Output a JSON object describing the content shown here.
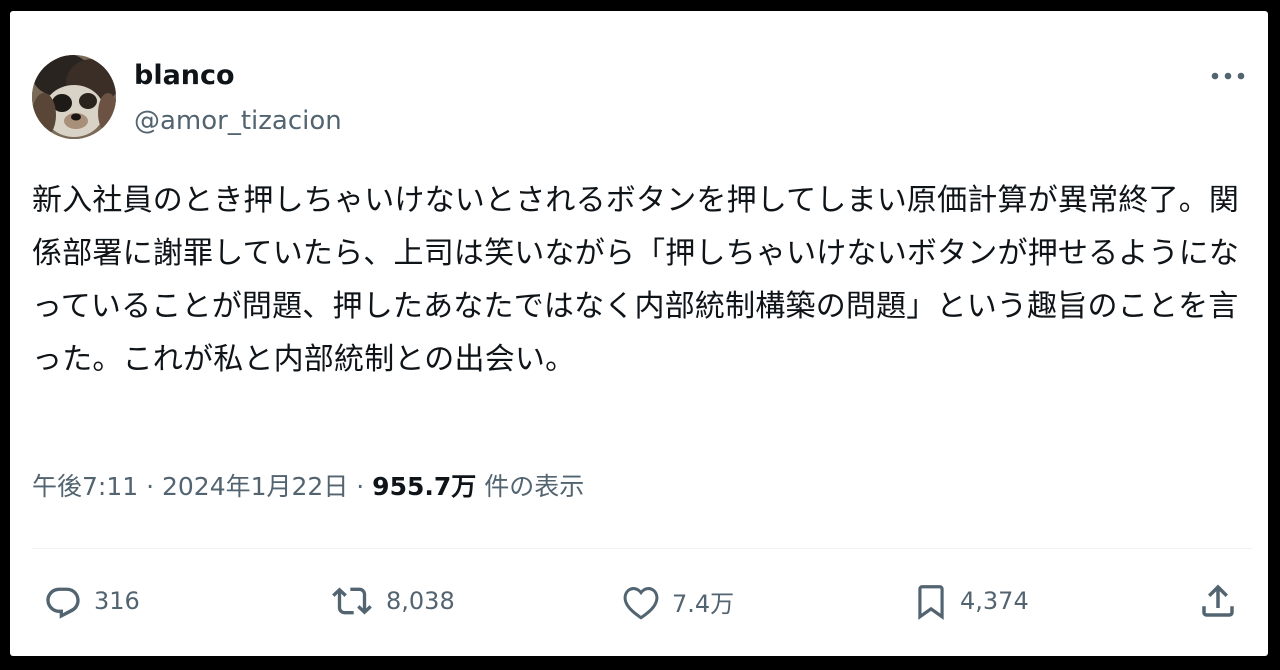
{
  "author": {
    "display_name": "blanco",
    "handle": "@amor_tizacion"
  },
  "tweet": {
    "text": "新入社員のとき押しちゃいけないとされるボタンを押してしまい原価計算が異常終了。関係部署に謝罪していたら、上司は笑いながら「押しちゃいけないボタンが押せるようになっていることが問題、押したあなたではなく内部統制構築の問題」という趣旨のことを言った。これが私と内部統制との出会い。"
  },
  "meta": {
    "time": "午後7:11",
    "separator": " · ",
    "date": "2024年1月22日",
    "views_count": "955.7万",
    "views_label": " 件の表示"
  },
  "actions": {
    "replies": {
      "count": "316",
      "icon": "reply-icon"
    },
    "retweets": {
      "count": "8,038",
      "icon": "retweet-icon"
    },
    "likes": {
      "count": "7.4万",
      "icon": "heart-icon"
    },
    "bookmarks": {
      "count": "4,374",
      "icon": "bookmark-icon"
    },
    "share": {
      "icon": "share-icon"
    }
  },
  "colors": {
    "text_primary": "#0f1419",
    "text_secondary": "#536471",
    "divider": "#eff3f4",
    "background": "#ffffff",
    "frame": "#000000"
  }
}
